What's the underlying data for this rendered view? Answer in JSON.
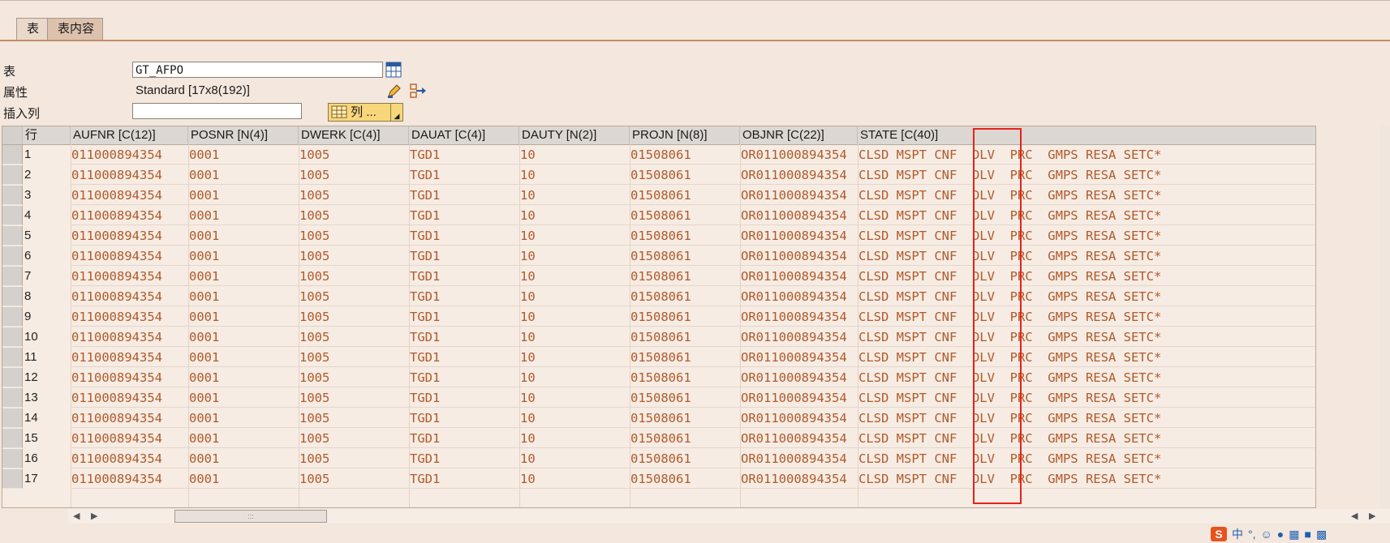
{
  "tabs": [
    {
      "label": "表"
    },
    {
      "label": "表内容"
    }
  ],
  "form": {
    "table_label": "表",
    "table_value": "GT_AFPO",
    "attr_label": "属性",
    "attr_value": "Standard [17x8(192)]",
    "insert_label": "插入列",
    "insert_value": "",
    "columns_button": "列 ..."
  },
  "grid": {
    "row_header": "行",
    "columns": [
      "AUFNR [C(12)]",
      "POSNR [N(4)]",
      "DWERK [C(4)]",
      "DAUAT [C(4)]",
      "DAUTY [N(2)]",
      "PROJN [N(8)]",
      "OBJNR [C(22)]",
      "STATE [C(40)]"
    ],
    "rows": [
      {
        "n": "1",
        "cells": [
          "011000894354",
          "0001",
          "1005",
          "TGD1",
          "10",
          "01508061",
          "OR011000894354",
          "CLSD MSPT CNF  DLV  PRC  GMPS RESA SETC*"
        ]
      },
      {
        "n": "2",
        "cells": [
          "011000894354",
          "0001",
          "1005",
          "TGD1",
          "10",
          "01508061",
          "OR011000894354",
          "CLSD MSPT CNF  DLV  PRC  GMPS RESA SETC*"
        ]
      },
      {
        "n": "3",
        "cells": [
          "011000894354",
          "0001",
          "1005",
          "TGD1",
          "10",
          "01508061",
          "OR011000894354",
          "CLSD MSPT CNF  DLV  PRC  GMPS RESA SETC*"
        ]
      },
      {
        "n": "4",
        "cells": [
          "011000894354",
          "0001",
          "1005",
          "TGD1",
          "10",
          "01508061",
          "OR011000894354",
          "CLSD MSPT CNF  DLV  PRC  GMPS RESA SETC*"
        ]
      },
      {
        "n": "5",
        "cells": [
          "011000894354",
          "0001",
          "1005",
          "TGD1",
          "10",
          "01508061",
          "OR011000894354",
          "CLSD MSPT CNF  DLV  PRC  GMPS RESA SETC*"
        ]
      },
      {
        "n": "6",
        "cells": [
          "011000894354",
          "0001",
          "1005",
          "TGD1",
          "10",
          "01508061",
          "OR011000894354",
          "CLSD MSPT CNF  DLV  PRC  GMPS RESA SETC*"
        ]
      },
      {
        "n": "7",
        "cells": [
          "011000894354",
          "0001",
          "1005",
          "TGD1",
          "10",
          "01508061",
          "OR011000894354",
          "CLSD MSPT CNF  DLV  PRC  GMPS RESA SETC*"
        ]
      },
      {
        "n": "8",
        "cells": [
          "011000894354",
          "0001",
          "1005",
          "TGD1",
          "10",
          "01508061",
          "OR011000894354",
          "CLSD MSPT CNF  DLV  PRC  GMPS RESA SETC*"
        ]
      },
      {
        "n": "9",
        "cells": [
          "011000894354",
          "0001",
          "1005",
          "TGD1",
          "10",
          "01508061",
          "OR011000894354",
          "CLSD MSPT CNF  DLV  PRC  GMPS RESA SETC*"
        ]
      },
      {
        "n": "10",
        "cells": [
          "011000894354",
          "0001",
          "1005",
          "TGD1",
          "10",
          "01508061",
          "OR011000894354",
          "CLSD MSPT CNF  DLV  PRC  GMPS RESA SETC*"
        ]
      },
      {
        "n": "11",
        "cells": [
          "011000894354",
          "0001",
          "1005",
          "TGD1",
          "10",
          "01508061",
          "OR011000894354",
          "CLSD MSPT CNF  DLV  PRC  GMPS RESA SETC*"
        ]
      },
      {
        "n": "12",
        "cells": [
          "011000894354",
          "0001",
          "1005",
          "TGD1",
          "10",
          "01508061",
          "OR011000894354",
          "CLSD MSPT CNF  DLV  PRC  GMPS RESA SETC*"
        ]
      },
      {
        "n": "13",
        "cells": [
          "011000894354",
          "0001",
          "1005",
          "TGD1",
          "10",
          "01508061",
          "OR011000894354",
          "CLSD MSPT CNF  DLV  PRC  GMPS RESA SETC*"
        ]
      },
      {
        "n": "14",
        "cells": [
          "011000894354",
          "0001",
          "1005",
          "TGD1",
          "10",
          "01508061",
          "OR011000894354",
          "CLSD MSPT CNF  DLV  PRC  GMPS RESA SETC*"
        ]
      },
      {
        "n": "15",
        "cells": [
          "011000894354",
          "0001",
          "1005",
          "TGD1",
          "10",
          "01508061",
          "OR011000894354",
          "CLSD MSPT CNF  DLV  PRC  GMPS RESA SETC*"
        ]
      },
      {
        "n": "16",
        "cells": [
          "011000894354",
          "0001",
          "1005",
          "TGD1",
          "10",
          "01508061",
          "OR011000894354",
          "CLSD MSPT CNF  DLV  PRC  GMPS RESA SETC*"
        ]
      },
      {
        "n": "17",
        "cells": [
          "011000894354",
          "0001",
          "1005",
          "TGD1",
          "10",
          "01508061",
          "OR011000894354",
          "CLSD MSPT CNF  DLV  PRC  GMPS RESA SETC*"
        ]
      }
    ]
  },
  "tray": {
    "logo": "S",
    "lang": "中"
  },
  "colors": {
    "cell_text": "#b05a2c",
    "highlight_box": "#e8221c"
  }
}
